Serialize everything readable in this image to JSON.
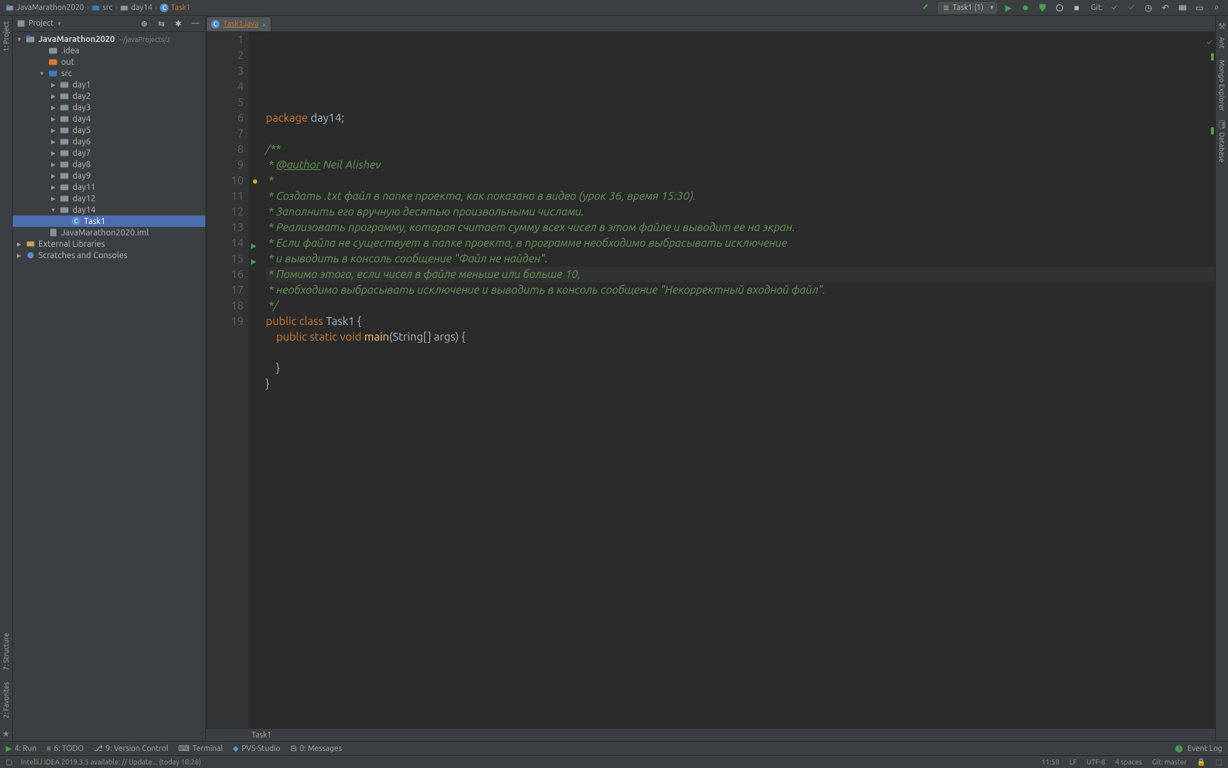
{
  "breadcrumb": [
    {
      "icon": "folder-root",
      "label": "JavaMarathon2020"
    },
    {
      "icon": "folder-blue",
      "label": "src"
    },
    {
      "icon": "folder",
      "label": "day14"
    },
    {
      "icon": "class",
      "label": "Task1"
    }
  ],
  "runConfig": {
    "label": "Task1 (1)"
  },
  "gitLabel": "Git:",
  "leftTabs": {
    "project": "1: Project",
    "structure": "7: Structure",
    "favorites": "2: Favorites"
  },
  "rightTabs": {
    "ant": "Ant",
    "mongo": "Mongo Explorer",
    "database": "Database"
  },
  "sidebar": {
    "title": "Project",
    "root": {
      "name": "JavaMarathon2020",
      "hint": "~/javaProjects/J"
    },
    "children": [
      {
        "name": ".idea",
        "icon": "folder",
        "depth": 2
      },
      {
        "name": "out",
        "icon": "folder-orange",
        "depth": 2
      },
      {
        "name": "src",
        "icon": "folder-blue",
        "depth": 2,
        "expanded": true
      },
      {
        "name": "day1",
        "icon": "folder",
        "depth": 3,
        "arrow": true
      },
      {
        "name": "day2",
        "icon": "folder",
        "depth": 3,
        "arrow": true
      },
      {
        "name": "day3",
        "icon": "folder",
        "depth": 3,
        "arrow": true
      },
      {
        "name": "day4",
        "icon": "folder",
        "depth": 3,
        "arrow": true
      },
      {
        "name": "day5",
        "icon": "folder",
        "depth": 3,
        "arrow": true
      },
      {
        "name": "day6",
        "icon": "folder",
        "depth": 3,
        "arrow": true
      },
      {
        "name": "day7",
        "icon": "folder",
        "depth": 3,
        "arrow": true
      },
      {
        "name": "day8",
        "icon": "folder",
        "depth": 3,
        "arrow": true
      },
      {
        "name": "day9",
        "icon": "folder",
        "depth": 3,
        "arrow": true
      },
      {
        "name": "day11",
        "icon": "folder",
        "depth": 3,
        "arrow": true
      },
      {
        "name": "day12",
        "icon": "folder",
        "depth": 3,
        "arrow": true
      },
      {
        "name": "day14",
        "icon": "folder",
        "depth": 3,
        "arrow": true,
        "expanded": true
      },
      {
        "name": "Task1",
        "icon": "class",
        "depth": 4,
        "selected": true
      },
      {
        "name": "JavaMarathon2020.iml",
        "icon": "iml",
        "depth": 2
      }
    ],
    "external": "External Libraries",
    "scratches": "Scratches and Consoles"
  },
  "tab": {
    "name": "Task1.java"
  },
  "code": {
    "lines": [
      [
        {
          "t": "package ",
          "c": "kw"
        },
        {
          "t": "day14",
          "c": "ident"
        },
        {
          "t": ";",
          "c": "ident"
        }
      ],
      [],
      [
        {
          "t": "/**",
          "c": "comment"
        }
      ],
      [
        {
          "t": " * ",
          "c": "comment"
        },
        {
          "t": "@author",
          "c": "doctag"
        },
        {
          "t": " Neil Alishev",
          "c": "comment"
        }
      ],
      [
        {
          "t": " *",
          "c": "comment"
        }
      ],
      [
        {
          "t": " * Создать .txt файл в папке проекта, как показано в видео (урок 36, время 15:30).",
          "c": "comment"
        }
      ],
      [
        {
          "t": " * Заполнить его вручную десятью произвольными числами.",
          "c": "comment"
        }
      ],
      [
        {
          "t": " * Реализовать программу, которая считает сумму всех чисел в этом файле и выводит ее на экран.",
          "c": "comment"
        }
      ],
      [
        {
          "t": " * Если файла не существует в папке проекта, в программе необходимо выбрасывать исключение",
          "c": "comment"
        }
      ],
      [
        {
          "t": " * и выводить в консоль сообщение \"Файл не найден\".",
          "c": "comment"
        }
      ],
      [
        {
          "t": " * Помимо этого, если чисел в файле меньше или больше 10,",
          "c": "comment"
        }
      ],
      [
        {
          "t": " * необходимо выбрасывать исключение и выводить в консоль сообщение \"Некорректный входной файл\".",
          "c": "comment"
        }
      ],
      [
        {
          "t": " */",
          "c": "comment"
        }
      ],
      [
        {
          "t": "public class ",
          "c": "kw"
        },
        {
          "t": "Task1 ",
          "c": "cl"
        },
        {
          "t": "{",
          "c": "ident"
        }
      ],
      [
        {
          "t": "    public static void ",
          "c": "kw"
        },
        {
          "t": "main",
          "c": "method"
        },
        {
          "t": "(String[] args) {",
          "c": "ident"
        }
      ],
      [],
      [
        {
          "t": "    }",
          "c": "ident"
        }
      ],
      [
        {
          "t": "}",
          "c": "ident"
        }
      ],
      []
    ],
    "currentLine": 11,
    "bulbLine": 10,
    "runLines": [
      14,
      15
    ]
  },
  "editorCrumb": "Task1",
  "bottom": {
    "run": "4: Run",
    "todo": "6: TODO",
    "vcs": "9: Version Control",
    "terminal": "Terminal",
    "pvs": "PVS-Studio",
    "messages": "0: Messages",
    "eventLog": "Event Log"
  },
  "status": {
    "left": "IntelliJ IDEA 2019.3.5 available: // Update... (today 18:28)",
    "pos": "11:58",
    "le": "LF",
    "enc": "UTF-8",
    "indent": "4 spaces",
    "branch": "Git: master"
  }
}
